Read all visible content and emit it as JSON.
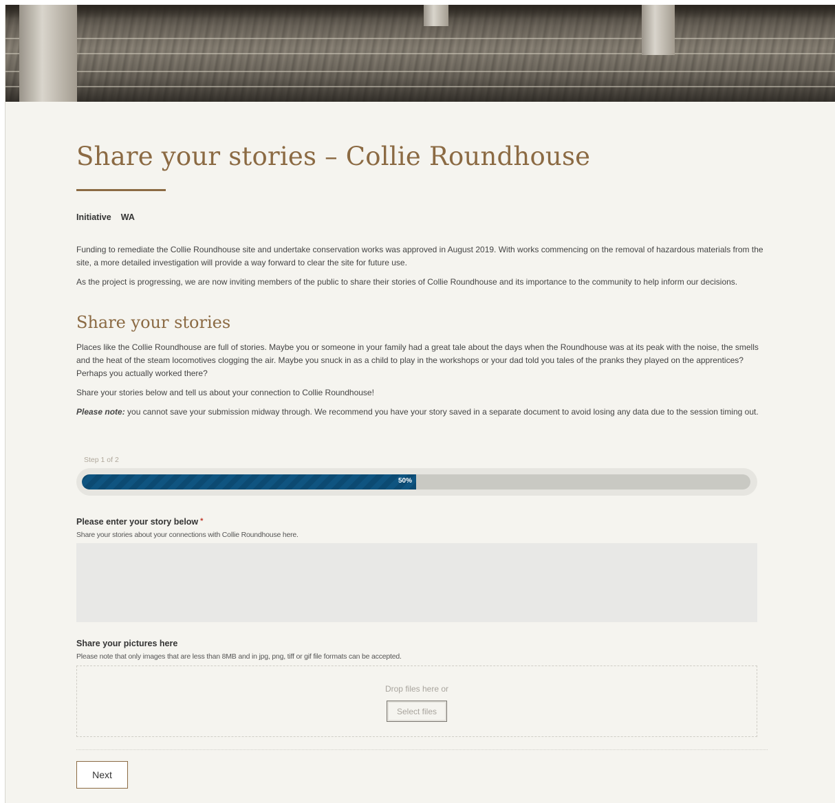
{
  "page": {
    "title": "Share your stories – Collie Roundhouse",
    "meta": {
      "label": "Initiative",
      "value": "WA"
    },
    "intro": [
      "Funding to remediate the Collie Roundhouse site and undertake conservation works was approved in August 2019. With works commencing on the removal of hazardous materials from the site, a more detailed investigation will provide a way forward to clear the site for future use.",
      "As the project is progressing, we are now inviting members of the public to share their stories of Collie Roundhouse and its importance to the community to help inform our decisions."
    ],
    "section_title": "Share your stories",
    "body": [
      "Places like the Collie Roundhouse are full of stories. Maybe you or someone in your family had a great tale about the days when the Roundhouse was at its peak with the noise, the smells and the heat of the steam locomotives clogging the air. Maybe you snuck in as a child to play in the workshops or your dad told you tales of the pranks they played on the apprentices? Perhaps you actually worked there?",
      "Share your stories below and tell us about your connection to Collie Roundhouse!"
    ],
    "note": {
      "label": "Please note:",
      "text": " you cannot save your submission midway through. We recommend you have your story saved in a separate document to avoid losing any data due to the session timing out."
    }
  },
  "form": {
    "step_label": "Step 1 of 2",
    "progress": {
      "fraction": 0.5,
      "text": "50%"
    },
    "story": {
      "label": "Please enter your story below",
      "required_mark": "*",
      "description": "Share your stories about your connections with Collie Roundhouse here.",
      "value": ""
    },
    "pictures": {
      "label": "Share your pictures here",
      "description": "Please note that only images that are less than 8MB and in jpg, png, tiff or gif file formats can be accepted.",
      "drop_text": "Drop files here or",
      "select_label": "Select files"
    },
    "next_label": "Next"
  },
  "colors": {
    "accent": "#8b6a43",
    "progress_fill": "#0c4a72",
    "page_bg": "#f5f4ef"
  }
}
